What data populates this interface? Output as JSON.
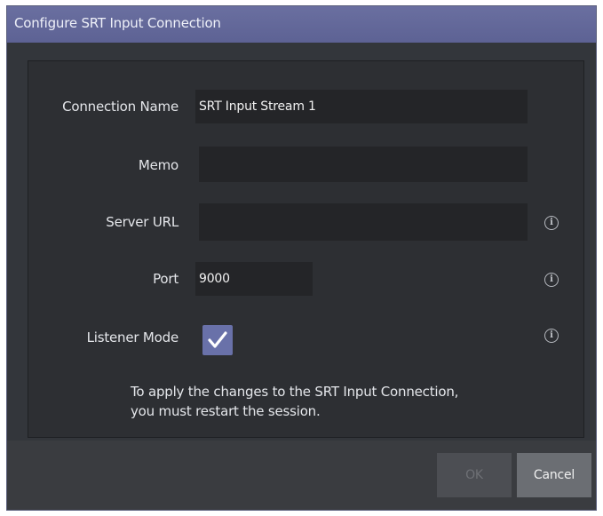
{
  "dialog": {
    "title": "Configure SRT Input Connection"
  },
  "fields": {
    "connection_name": {
      "label": "Connection Name",
      "value": "SRT Input Stream 1"
    },
    "memo": {
      "label": "Memo",
      "value": ""
    },
    "server_url": {
      "label": "Server URL",
      "value": ""
    },
    "port": {
      "label": "Port",
      "value": "9000"
    },
    "listener_mode": {
      "label": "Listener Mode",
      "checked": true
    }
  },
  "icons": {
    "info": "info-icon",
    "check": "checkmark-icon"
  },
  "note": {
    "line1": "To apply the changes to the SRT Input Connection,",
    "line2": "you must restart the session."
  },
  "buttons": {
    "ok": "OK",
    "cancel": "Cancel"
  },
  "colors": {
    "title_bar": "#5d6294",
    "checkbox_accent": "#6971a9",
    "background": "#33363b"
  }
}
